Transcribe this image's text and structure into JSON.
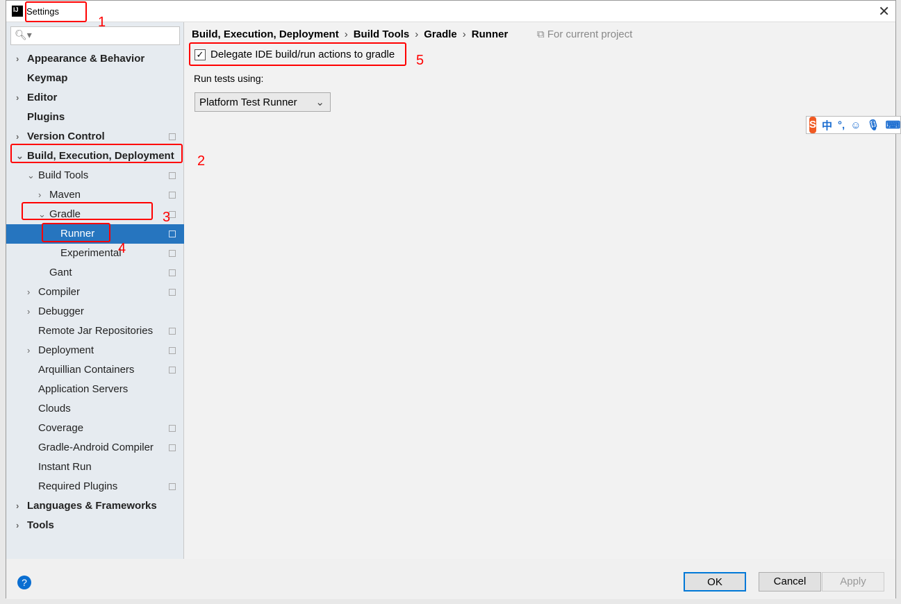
{
  "window": {
    "title": "Settings",
    "logo": "IJ"
  },
  "search": {
    "placeholder": ""
  },
  "tree": [
    {
      "label": "Appearance & Behavior",
      "level": 0,
      "bold": true,
      "arrow": "›",
      "copy": false
    },
    {
      "label": "Keymap",
      "level": 0,
      "bold": true,
      "arrow": "",
      "copy": false
    },
    {
      "label": "Editor",
      "level": 0,
      "bold": true,
      "arrow": "›",
      "copy": false
    },
    {
      "label": "Plugins",
      "level": 0,
      "bold": true,
      "arrow": "",
      "copy": false
    },
    {
      "label": "Version Control",
      "level": 0,
      "bold": true,
      "arrow": "›",
      "copy": true
    },
    {
      "label": "Build, Execution, Deployment",
      "level": 0,
      "bold": true,
      "arrow": "⌄",
      "copy": false
    },
    {
      "label": "Build Tools",
      "level": 1,
      "arrow": "⌄",
      "copy": true
    },
    {
      "label": "Maven",
      "level": 2,
      "arrow": "›",
      "copy": true
    },
    {
      "label": "Gradle",
      "level": 2,
      "arrow": "⌄",
      "copy": true
    },
    {
      "label": "Runner",
      "level": 3,
      "arrow": "",
      "copy": true,
      "selected": true
    },
    {
      "label": "Experimental",
      "level": 3,
      "arrow": "",
      "copy": true
    },
    {
      "label": "Gant",
      "level": 2,
      "arrow": "",
      "copy": true
    },
    {
      "label": "Compiler",
      "level": 1,
      "arrow": "›",
      "copy": true
    },
    {
      "label": "Debugger",
      "level": 1,
      "arrow": "›",
      "copy": false
    },
    {
      "label": "Remote Jar Repositories",
      "level": 1,
      "arrow": "",
      "copy": true
    },
    {
      "label": "Deployment",
      "level": 1,
      "arrow": "›",
      "copy": true
    },
    {
      "label": "Arquillian Containers",
      "level": 1,
      "arrow": "",
      "copy": true
    },
    {
      "label": "Application Servers",
      "level": 1,
      "arrow": "",
      "copy": false
    },
    {
      "label": "Clouds",
      "level": 1,
      "arrow": "",
      "copy": false
    },
    {
      "label": "Coverage",
      "level": 1,
      "arrow": "",
      "copy": true
    },
    {
      "label": "Gradle-Android Compiler",
      "level": 1,
      "arrow": "",
      "copy": true
    },
    {
      "label": "Instant Run",
      "level": 1,
      "arrow": "",
      "copy": false
    },
    {
      "label": "Required Plugins",
      "level": 1,
      "arrow": "",
      "copy": true
    },
    {
      "label": "Languages & Frameworks",
      "level": 0,
      "bold": true,
      "arrow": "›",
      "copy": false
    },
    {
      "label": "Tools",
      "level": 0,
      "bold": true,
      "arrow": "›",
      "copy": false
    }
  ],
  "breadcrumb": [
    "Build, Execution, Deployment",
    "Build Tools",
    "Gradle",
    "Runner"
  ],
  "breadcrumb_sep": "›",
  "for_project": "For current project",
  "delegate": {
    "label": "Delegate IDE build/run actions to gradle",
    "checked": true
  },
  "run_tests": {
    "label": "Run tests using:",
    "value": "Platform Test Runner"
  },
  "buttons": {
    "ok": "OK",
    "cancel": "Cancel",
    "apply": "Apply",
    "help": "?"
  },
  "ime": {
    "logo": "S",
    "mode": "中",
    "punct": "°,"
  },
  "annotations": [
    "1",
    "2",
    "3",
    "4",
    "5"
  ],
  "colors": {
    "selection": "#2675bf",
    "annotation": "#ff0000"
  }
}
